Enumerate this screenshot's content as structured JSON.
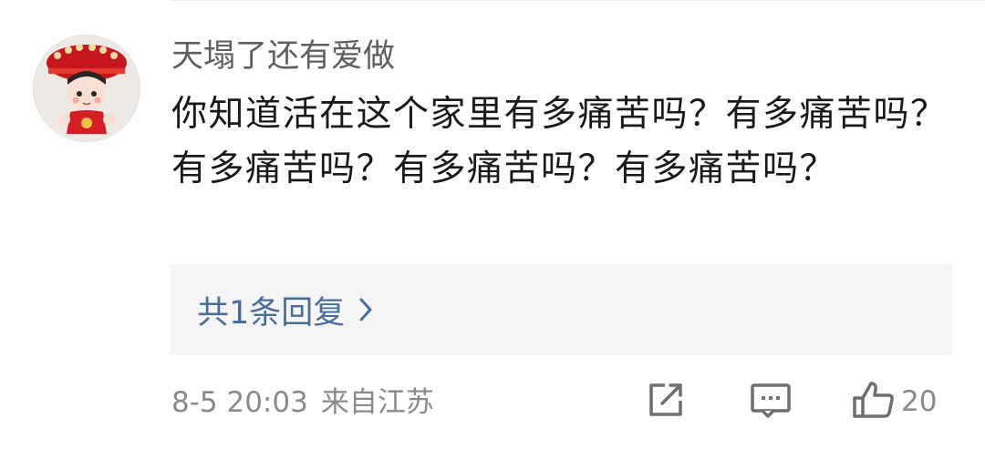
{
  "comment": {
    "username": "天塌了还有爱做",
    "text": "你知道活在这个家里有多痛苦吗？有多痛苦吗？有多痛苦吗？有多痛苦吗？有多痛苦吗？",
    "replies_label": "共1条回复",
    "time": "8-5 20:03",
    "location": "来自江苏",
    "like_count": "20"
  },
  "colors": {
    "link": "#4a6e9c",
    "meta": "#8a8a8a",
    "username": "#5f5f5f",
    "text": "#1a1a1a",
    "reply_bg": "#f5f5f5"
  },
  "icons": {
    "forward": "share-forward-icon",
    "comment": "comment-bubble-icon",
    "like": "thumbs-up-icon",
    "reply_chevron": "chevron-right-icon"
  }
}
